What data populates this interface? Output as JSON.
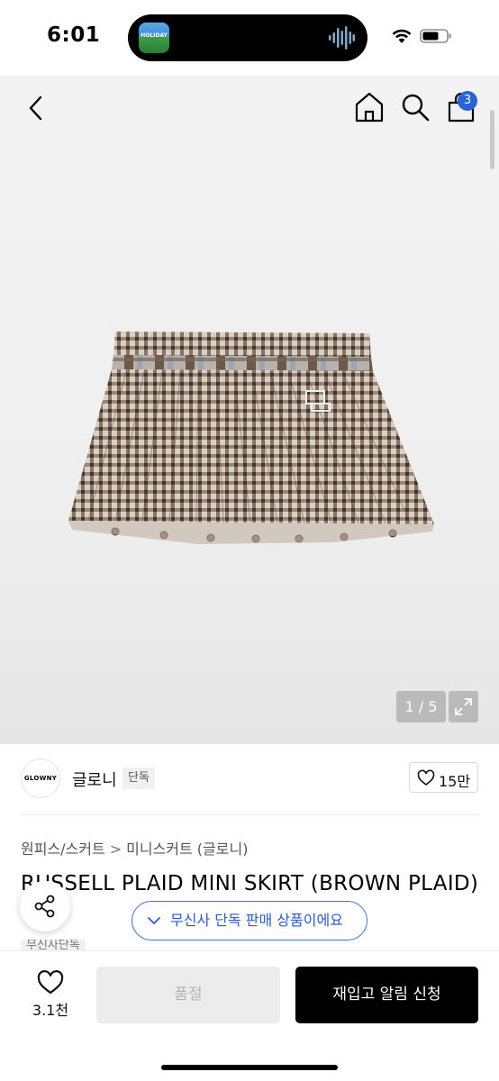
{
  "status_bar": {
    "time": "6:01",
    "island_app_label": "HOLIDAY",
    "wifi_icon": "wifi-icon",
    "battery_icon": "battery-icon"
  },
  "header": {
    "back_icon": "chevron-left-icon",
    "home_icon": "home-icon",
    "search_icon": "search-icon",
    "cart_icon": "shopping-bag-icon",
    "cart_badge": "3",
    "badge_color": "#2a63d6"
  },
  "gallery": {
    "page_indicator": "1 / 5",
    "expand_icon": "expand-icon"
  },
  "brand": {
    "logo_text": "GLOWNY",
    "name": "글로니",
    "tag": "단독",
    "like_count": "15만"
  },
  "breadcrumb": {
    "category": "원피스/스커트",
    "separator": ">",
    "subcategory": "미니스커트 (글로니)"
  },
  "product": {
    "title": "RUSSELL PLAID MINI SKIRT (BROWN PLAID)",
    "tag": "무신사단독"
  },
  "floating": {
    "share_icon": "share-icon",
    "exclusive_notice": "무신사 단독 판매 상품이에요",
    "accent_color": "#3e6fe0"
  },
  "bottom_bar": {
    "wish_count": "3.1천",
    "soldout_label": "품절",
    "restock_label": "재입고 알림 신청"
  }
}
